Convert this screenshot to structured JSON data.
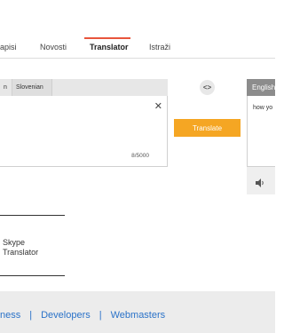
{
  "nav": {
    "tabs": [
      {
        "label": "apisi",
        "active": false
      },
      {
        "label": "Novosti",
        "active": false
      },
      {
        "label": "Translator",
        "active": true
      },
      {
        "label": "Istraži",
        "active": false
      }
    ],
    "active_color": "#e8553c"
  },
  "source": {
    "language_tabs": [
      "n",
      "Slovenian"
    ],
    "char_count": "8/5000",
    "clear_icon": "close-icon"
  },
  "swap_icon": "swap-icon",
  "translate_button": {
    "label": "Translate",
    "color": "#f5a623"
  },
  "target": {
    "language": "English",
    "text": "how yo",
    "speaker_icon": "speaker-icon"
  },
  "skype": {
    "line1": "Skype",
    "line2": "Translator"
  },
  "footer": {
    "links": [
      "ness",
      "Developers",
      "Webmasters"
    ],
    "separator": "|",
    "link_color": "#2a72c8"
  }
}
